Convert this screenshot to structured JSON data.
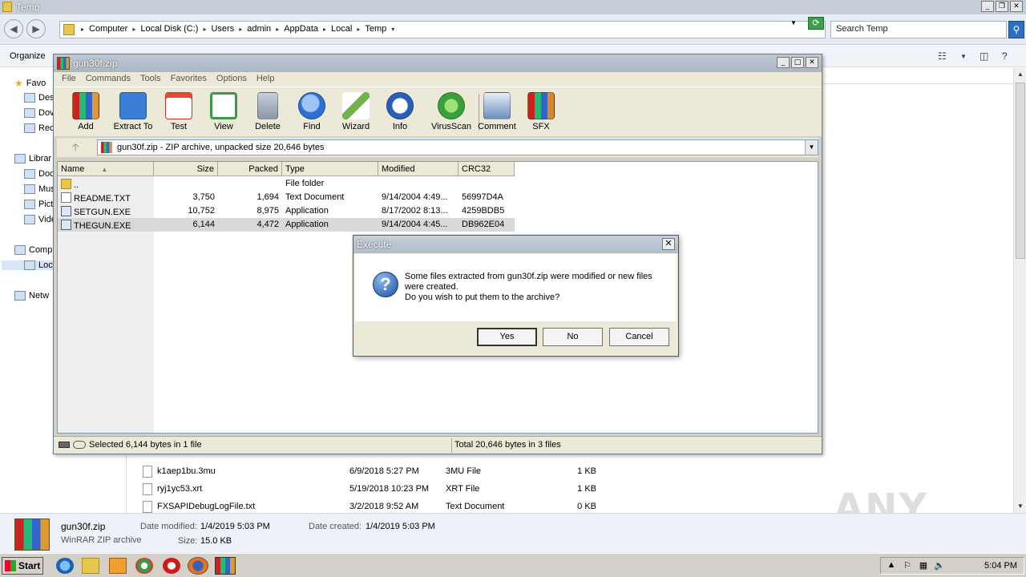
{
  "explorer": {
    "title": "Temp",
    "breadcrumbs": [
      "Computer",
      "Local Disk (C:)",
      "Users",
      "admin",
      "AppData",
      "Local",
      "Temp"
    ],
    "search_placeholder": "Search Temp",
    "organize_label": "Organize",
    "nav": {
      "favorites": "Favo",
      "desktop": "Des",
      "downloads": "Dov",
      "recent": "Rec",
      "libraries": "Librar",
      "documents": "Doc",
      "music": "Mus",
      "pictures": "Pict",
      "videos": "Vide",
      "computer": "Comp",
      "localdisk": "Loc",
      "network": "Netw"
    },
    "files": [
      {
        "name": "k1aep1bu.3mu",
        "date": "6/9/2018 5:27 PM",
        "type": "3MU File",
        "size": "1 KB"
      },
      {
        "name": "ryj1yc53.xrt",
        "date": "5/19/2018 10:23 PM",
        "type": "XRT File",
        "size": "1 KB"
      },
      {
        "name": "FXSAPIDebugLogFile.txt",
        "date": "3/2/2018 9:52 AM",
        "type": "Text Document",
        "size": "0 KB"
      }
    ],
    "details": {
      "name": "gun30f.zip",
      "kind": "WinRAR ZIP archive",
      "modified_label": "Date modified:",
      "modified": "1/4/2019 5:03 PM",
      "created_label": "Date created:",
      "created": "1/4/2019 5:03 PM",
      "size_label": "Size:",
      "size": "15.0 KB"
    },
    "watermark": "ANY RUN"
  },
  "winrar": {
    "title": "gun30f.zip",
    "menu": [
      "File",
      "Commands",
      "Tools",
      "Favorites",
      "Options",
      "Help"
    ],
    "toolbar": [
      {
        "label": "Add",
        "icon": "add-icon",
        "color": "#c23b22"
      },
      {
        "label": "Extract To",
        "icon": "extract-to-icon",
        "color": "#3a7fd5"
      },
      {
        "label": "Test",
        "icon": "test-icon",
        "color": "#e14a3a"
      },
      {
        "label": "View",
        "icon": "view-icon",
        "color": "#3a9a48"
      },
      {
        "label": "Delete",
        "icon": "delete-icon",
        "color": "#8a97a6"
      },
      {
        "label": "Find",
        "icon": "find-icon",
        "color": "#2e6fd0"
      },
      {
        "label": "Wizard",
        "icon": "wizard-icon",
        "color": "#6fb34a"
      },
      {
        "label": "Info",
        "icon": "info-icon",
        "color": "#2a5fb8"
      },
      {
        "label": "VirusScan",
        "icon": "virusscan-icon",
        "color": "#3aa03a"
      },
      {
        "label": "Comment",
        "icon": "comment-icon",
        "color": "#6a8fc0"
      },
      {
        "label": "SFX",
        "icon": "sfx-icon",
        "color": "#d8882a"
      }
    ],
    "path_text": "gun30f.zip - ZIP archive, unpacked size 20,646 bytes",
    "columns": [
      "Name",
      "Size",
      "Packed",
      "Type",
      "Modified",
      "CRC32"
    ],
    "rows": [
      {
        "name": "..",
        "size": "",
        "packed": "",
        "type": "File folder",
        "modified": "",
        "crc": "",
        "icon": "folder"
      },
      {
        "name": "README.TXT",
        "size": "3,750",
        "packed": "1,694",
        "type": "Text Document",
        "modified": "9/14/2004 4:49...",
        "crc": "56997D4A",
        "icon": "text"
      },
      {
        "name": "SETGUN.EXE",
        "size": "10,752",
        "packed": "8,975",
        "type": "Application",
        "modified": "8/17/2002 8:13...",
        "crc": "4259BDB5",
        "icon": "app"
      },
      {
        "name": "THEGUN.EXE",
        "size": "6,144",
        "packed": "4,472",
        "type": "Application",
        "modified": "9/14/2004 4:45...",
        "crc": "DB962E04",
        "icon": "app"
      }
    ],
    "status_left": "Selected 6,144 bytes in 1 file",
    "status_right": "Total 20,646 bytes in 3 files"
  },
  "dialog": {
    "title": "Execute",
    "message_line1": "Some files extracted from gun30f.zip were modified or new files",
    "message_line2": "were created.",
    "message_line3": "Do you wish to put them to the archive?",
    "yes": "Yes",
    "no": "No",
    "cancel": "Cancel"
  },
  "taskbar": {
    "start": "Start",
    "clock": "5:04 PM"
  }
}
